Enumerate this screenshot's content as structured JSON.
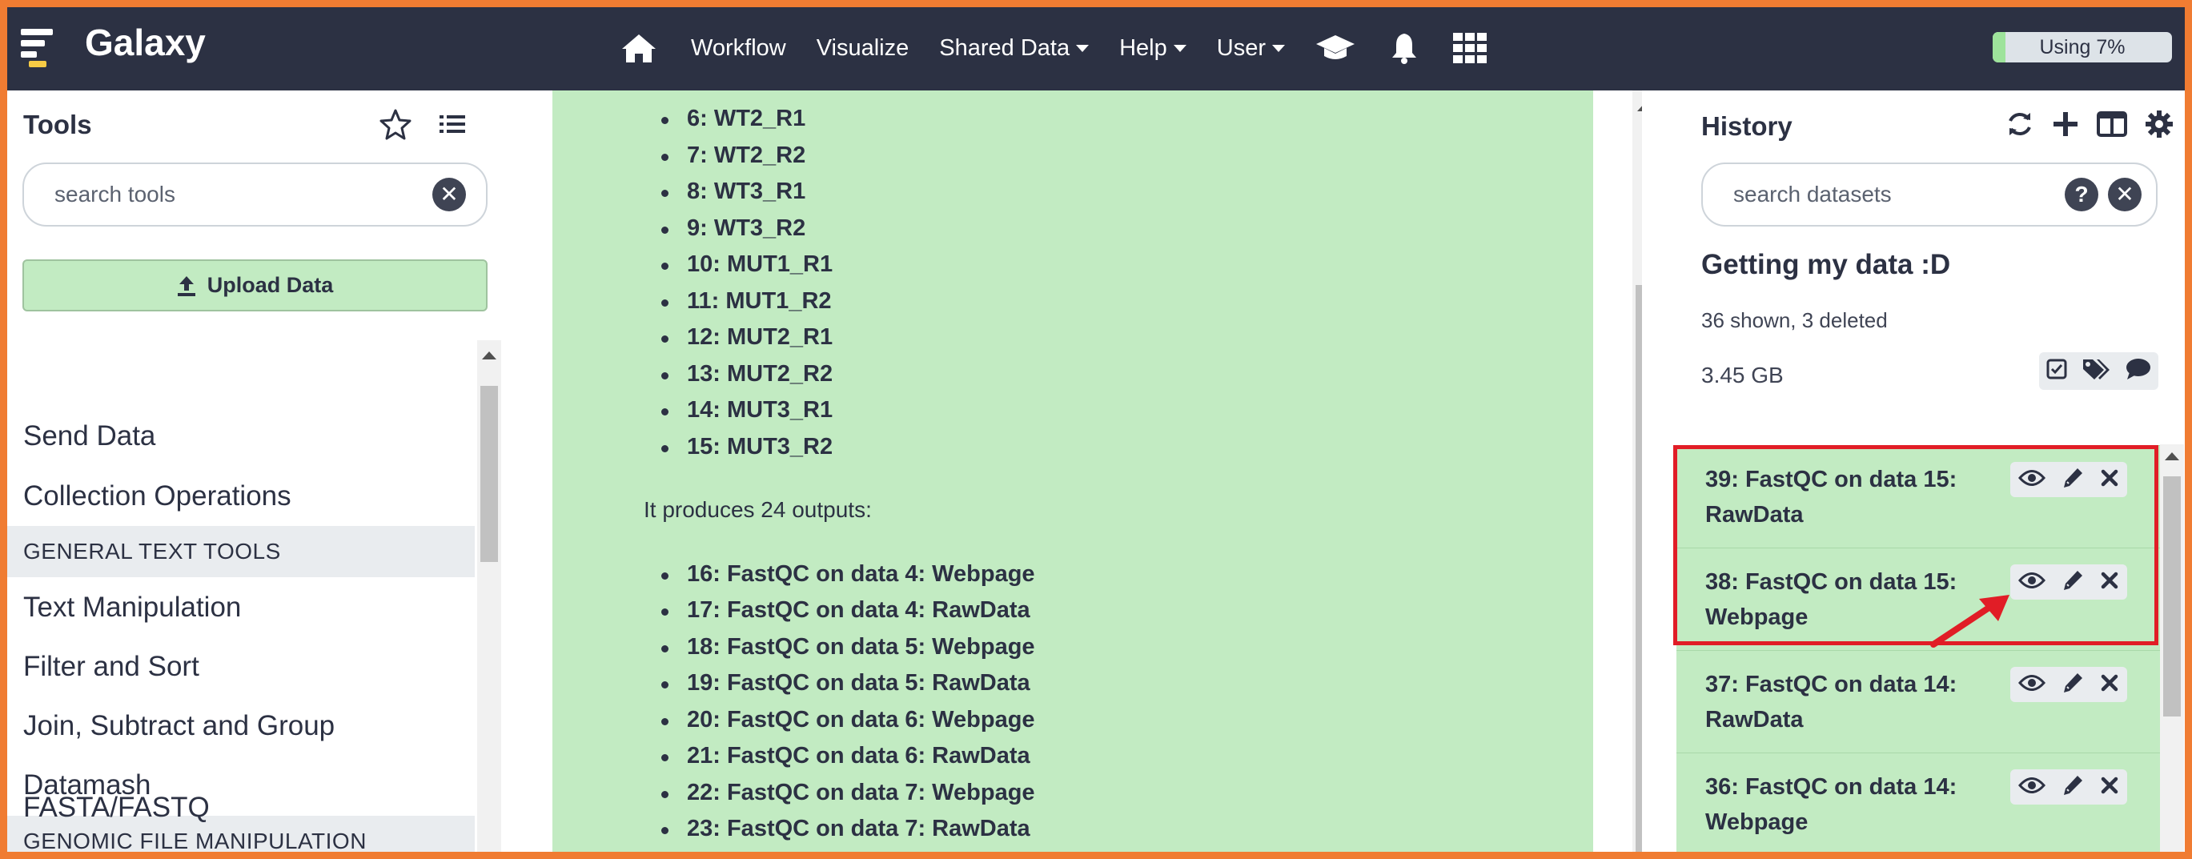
{
  "masthead": {
    "brand": "Galaxy",
    "nav": [
      {
        "label": "Workflow",
        "dropdown": false
      },
      {
        "label": "Visualize",
        "dropdown": false
      },
      {
        "label": "Shared Data",
        "dropdown": true
      },
      {
        "label": "Help",
        "dropdown": true
      },
      {
        "label": "User",
        "dropdown": true
      }
    ],
    "icons": [
      "home-icon",
      "graduation-cap-icon",
      "bell-icon",
      "grid-icon"
    ],
    "quota_label": "Using 7%",
    "quota_fraction": 0.07
  },
  "tool_panel": {
    "title": "Tools",
    "search_placeholder": "search tools",
    "upload_label": "Upload Data",
    "items": [
      {
        "type": "tool",
        "label": "Send Data"
      },
      {
        "type": "tool",
        "label": "Collection Operations"
      },
      {
        "type": "section",
        "label": "GENERAL TEXT TOOLS"
      },
      {
        "type": "tool",
        "label": "Text Manipulation"
      },
      {
        "type": "tool",
        "label": "Filter and Sort"
      },
      {
        "type": "tool",
        "label": "Join, Subtract and Group"
      },
      {
        "type": "tool",
        "label": "Datamash"
      },
      {
        "type": "section",
        "label": "GENOMIC FILE MANIPULATION"
      },
      {
        "type": "tool",
        "label": "FASTA/FASTQ"
      }
    ]
  },
  "center": {
    "inputs": [
      "6: WT2_R1",
      "7: WT2_R2",
      "8: WT3_R1",
      "9: WT3_R2",
      "10: MUT1_R1",
      "11: MUT1_R2",
      "12: MUT2_R1",
      "13: MUT2_R2",
      "14: MUT3_R1",
      "15: MUT3_R2"
    ],
    "outputs_intro": "It produces 24 outputs:",
    "outputs": [
      "16: FastQC on data 4: Webpage",
      "17: FastQC on data 4: RawData",
      "18: FastQC on data 5: Webpage",
      "19: FastQC on data 5: RawData",
      "20: FastQC on data 6: Webpage",
      "21: FastQC on data 6: RawData",
      "22: FastQC on data 7: Webpage",
      "23: FastQC on data 7: RawData"
    ]
  },
  "history": {
    "title": "History",
    "search_placeholder": "search datasets",
    "name": "Getting my data :D",
    "counts": "36 shown, 3 deleted",
    "size": "3.45 GB",
    "datasets": [
      {
        "title": "39: FastQC on data 15: RawData"
      },
      {
        "title": "38: FastQC on data 15: Webpage"
      },
      {
        "title": "37: FastQC on data 14: RawData"
      },
      {
        "title": "36: FastQC on data 14: Webpage"
      }
    ]
  },
  "colors": {
    "masthead": "#2c3143",
    "frame": "#f07c32",
    "ok_green": "#c2ebc2",
    "highlight": "#e11d26"
  }
}
